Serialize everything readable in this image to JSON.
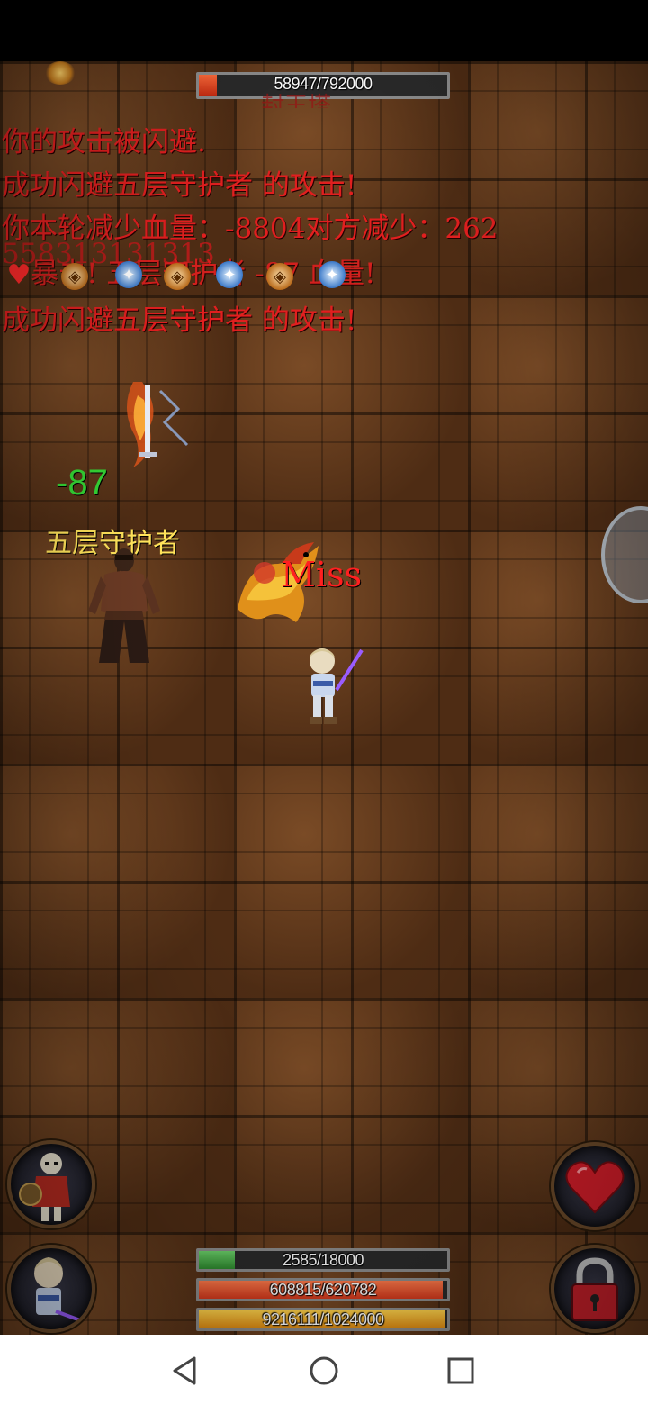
{
  "boss_hp": {
    "text": "58947/792000",
    "fraction": 0.074,
    "title_partial": "封王塔"
  },
  "combat_log": [
    "你的攻击被闪避.",
    "成功闪避五层守护者 的攻击!",
    "你本轮减少血量：-8804对方减少：262",
    "暴击! 五层守护者 -87 血量!",
    "成功闪避五层守护者 的攻击!"
  ],
  "overlap_number": "558313131313",
  "damage_text": "-87",
  "enemy_name": "五层守护者",
  "miss_text": "Miss",
  "player_bars": {
    "mp": {
      "text": "2585/18000",
      "fraction": 0.144
    },
    "hp": {
      "text": "608815/620782",
      "fraction": 0.981
    },
    "exp": {
      "text": "9216111/1024000",
      "fraction": 0.99
    }
  },
  "buttons": {
    "pet_icon": "skeleton-warrior-portrait",
    "hero_icon": "hero-portrait",
    "heal_icon": "heart-icon",
    "lock_icon": "lock-icon"
  },
  "colors": {
    "log_red": "#e11f1f",
    "damage_green": "#35d635",
    "name_yellow": "#ffe35a",
    "hp_fill": "#d4381c",
    "mp_fill": "#2e8b2e",
    "exp_fill": "#e08a10"
  }
}
